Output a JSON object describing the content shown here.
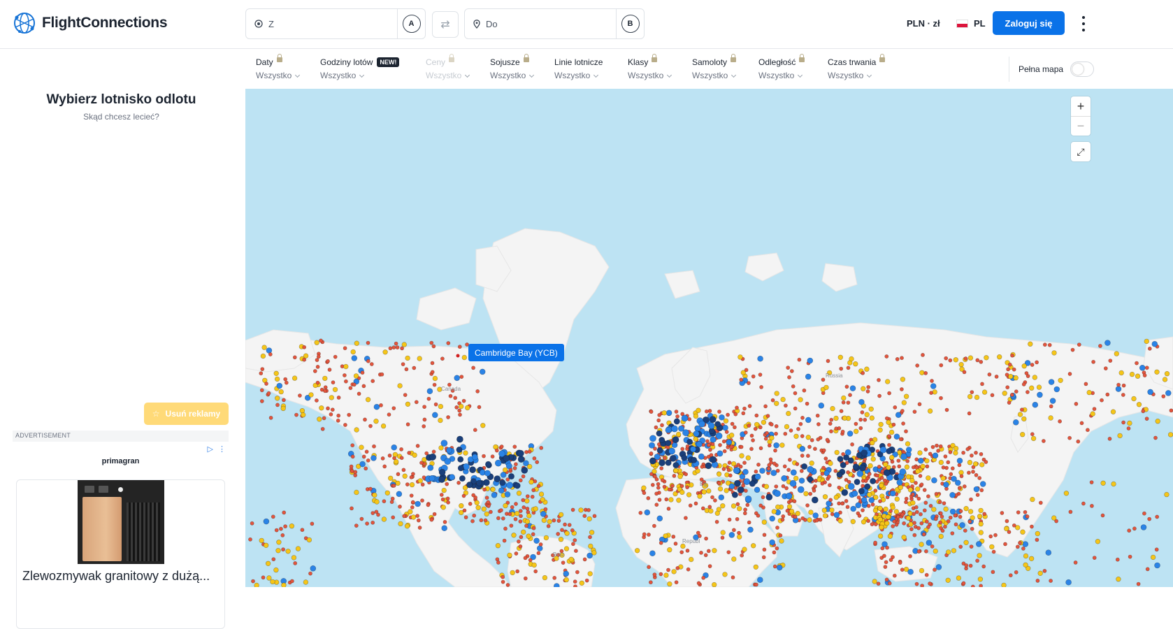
{
  "header": {
    "brand": "FlightConnections",
    "from_placeholder": "Z",
    "from_badge": "A",
    "to_placeholder": "Do",
    "to_badge": "B",
    "currency": "PLN · zł",
    "language": "PL",
    "login_label": "Zaloguj się"
  },
  "filters": [
    {
      "title": "Daty",
      "value": "Wszystko",
      "locked": true
    },
    {
      "title": "Godziny lotów",
      "value": "Wszystko",
      "badge": "NEW!"
    },
    {
      "title": "Ceny",
      "value": "Wszystko",
      "locked": true,
      "disabled": true
    },
    {
      "title": "Sojusze",
      "value": "Wszystko",
      "locked": true
    },
    {
      "title": "Linie lotnicze",
      "value": "Wszystko"
    },
    {
      "title": "Klasy",
      "value": "Wszystko",
      "locked": true
    },
    {
      "title": "Samoloty",
      "value": "Wszystko",
      "locked": true
    },
    {
      "title": "Odległość",
      "value": "Wszystko",
      "locked": true
    },
    {
      "title": "Czas trwania",
      "value": "Wszystko",
      "locked": true
    }
  ],
  "full_map_label": "Pełna mapa",
  "full_map_on": false,
  "left_panel": {
    "title": "Wybierz lotnisko odlotu",
    "subtitle": "Skąd chcesz lecieć?",
    "remove_ads": "Usuń reklamy",
    "ad_label": "ADVERTISEMENT",
    "ad_brand": "primagran",
    "ad_title": "Zlewozmywak granitowy z dużą..."
  },
  "map": {
    "tooltip": "Cambridge Bay (YCB)",
    "labels": [
      "Canada",
      "Russia",
      "Eg",
      "Republ",
      "Braz"
    ],
    "colors": {
      "water": "#bde3f3",
      "land": "#f4f4f4",
      "small": "#e2543c",
      "medium": "#f5c518",
      "large": "#2a83e6",
      "hub": "#1a3f7a"
    }
  }
}
